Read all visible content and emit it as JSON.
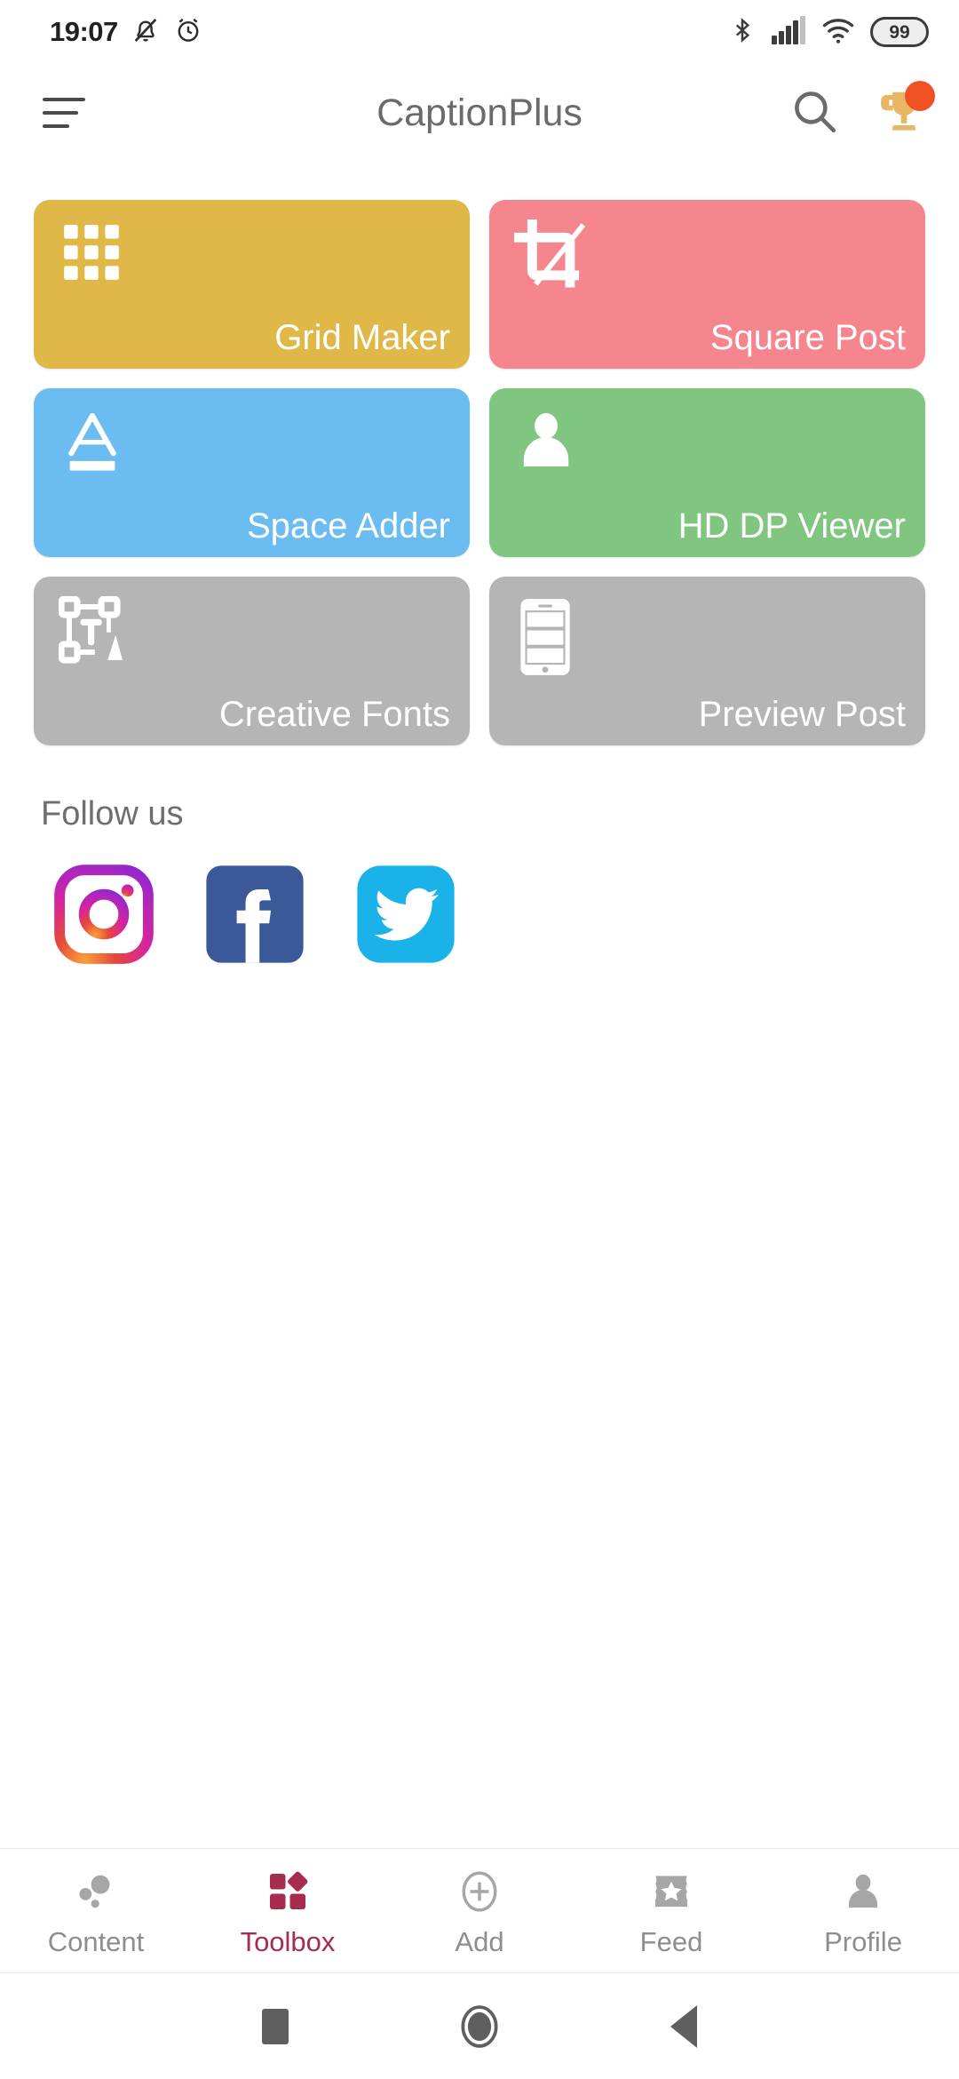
{
  "status_bar": {
    "time": "19:07",
    "icons_left": [
      "mute-notification-icon",
      "alarm-clock-icon"
    ],
    "icons_right": [
      "bluetooth-icon",
      "cellular-signal-icon",
      "wifi-icon"
    ],
    "battery_level": "99"
  },
  "app_bar": {
    "menu_icon": "hamburger-menu-icon",
    "title": "CaptionPlus",
    "search_icon": "search-icon",
    "trophy_icon": "trophy-icon",
    "trophy_has_badge": true,
    "trophy_color": "#e8b765",
    "badge_color": "#ef5125"
  },
  "tiles": [
    {
      "label": "Grid Maker",
      "icon": "grid-icon",
      "color": "#dfb848"
    },
    {
      "label": "Square Post",
      "icon": "crop-icon",
      "color": "#f5868e"
    },
    {
      "label": "Space Adder",
      "icon": "text-underline-icon",
      "color": "#6bbcf0"
    },
    {
      "label": "HD DP Viewer",
      "icon": "person-icon",
      "color": "#80c680"
    },
    {
      "label": "Creative Fonts",
      "icon": "text-transform-icon",
      "color": "#b5b5b5"
    },
    {
      "label": "Preview Post",
      "icon": "phone-preview-icon",
      "color": "#b5b5b5"
    }
  ],
  "follow": {
    "title": "Follow us",
    "socials": [
      {
        "name": "instagram-icon",
        "color": "#d6249f"
      },
      {
        "name": "facebook-icon",
        "color": "#3b5998"
      },
      {
        "name": "twitter-icon",
        "color": "#1ab2e8"
      }
    ]
  },
  "bottom_nav": {
    "active_color": "#a82c4e",
    "inactive_color": "#8e8e8e",
    "items": [
      {
        "label": "Content",
        "icon": "bubbles-icon",
        "active": false
      },
      {
        "label": "Toolbox",
        "icon": "toolbox-icon",
        "active": true
      },
      {
        "label": "Add",
        "icon": "plus-circle-icon",
        "active": false
      },
      {
        "label": "Feed",
        "icon": "star-ticket-icon",
        "active": false
      },
      {
        "label": "Profile",
        "icon": "person-icon",
        "active": false
      }
    ]
  },
  "system_nav": {
    "recents_icon": "square-recents-icon",
    "home_icon": "circle-home-icon",
    "back_icon": "triangle-back-icon"
  }
}
